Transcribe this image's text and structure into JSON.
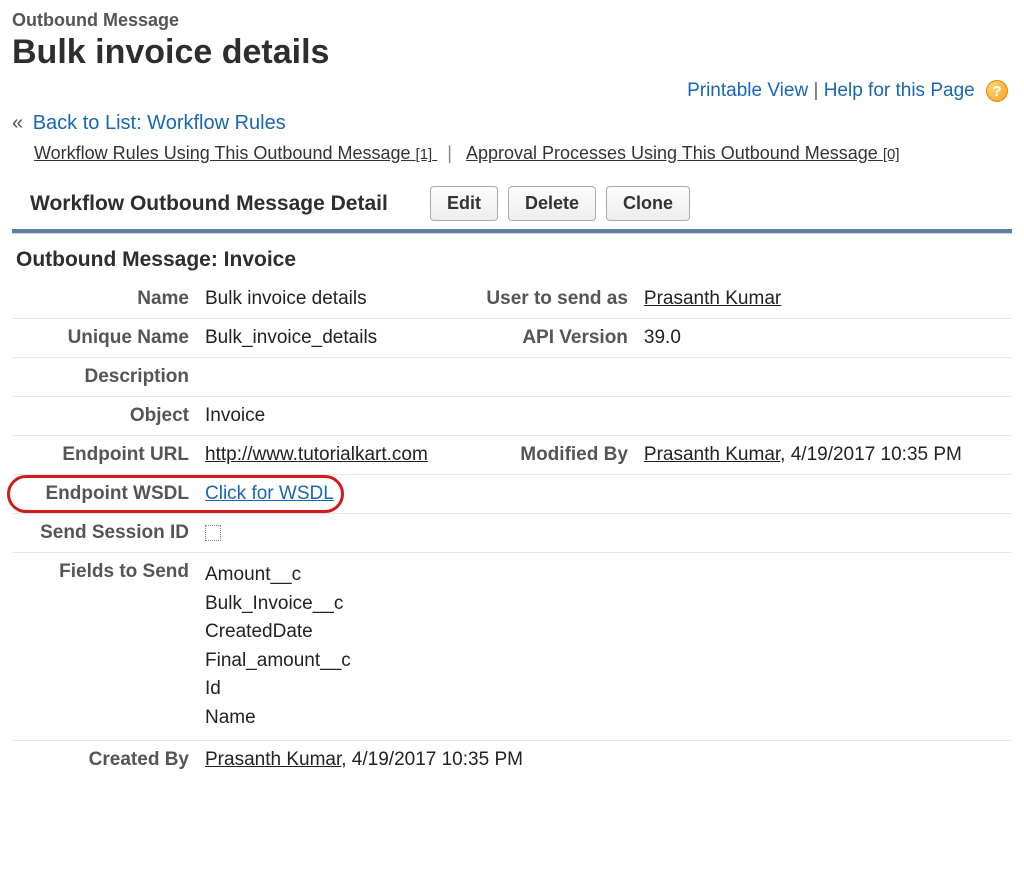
{
  "header": {
    "breadcrumb": "Outbound Message",
    "title": "Bulk invoice details",
    "printable": "Printable View",
    "help": "Help for this Page"
  },
  "back": {
    "label": "Back to List: Workflow Rules"
  },
  "related": {
    "workflow": "Workflow Rules Using This Outbound Message",
    "workflow_count": "[1]",
    "approval": "Approval Processes Using This Outbound Message",
    "approval_count": "[0]"
  },
  "section": {
    "title": "Workflow Outbound Message Detail",
    "edit": "Edit",
    "delete": "Delete",
    "clone": "Clone"
  },
  "subsection": "Outbound Message: Invoice",
  "labels": {
    "name": "Name",
    "unique_name": "Unique Name",
    "description": "Description",
    "object": "Object",
    "endpoint_url": "Endpoint URL",
    "endpoint_wsdl": "Endpoint WSDL",
    "send_session": "Send Session ID",
    "fields": "Fields to Send",
    "created_by": "Created By",
    "user_to_send": "User to send as",
    "api_version": "API Version",
    "modified_by": "Modified By"
  },
  "values": {
    "name": "Bulk invoice details",
    "unique_name": "Bulk_invoice_details",
    "description": "",
    "object": "Invoice",
    "endpoint_url": "http://www.tutorialkart.com",
    "endpoint_wsdl": "Click for WSDL",
    "user_to_send": "Prasanth Kumar",
    "api_version": "39.0",
    "modified_by_user": "Prasanth Kumar",
    "modified_by_date": ", 4/19/2017 10:35 PM",
    "created_by_user": "Prasanth Kumar",
    "created_by_date": ", 4/19/2017 10:35 PM",
    "fields": [
      "Amount__c",
      "Bulk_Invoice__c",
      "CreatedDate",
      "Final_amount__c",
      "Id",
      "Name"
    ]
  }
}
